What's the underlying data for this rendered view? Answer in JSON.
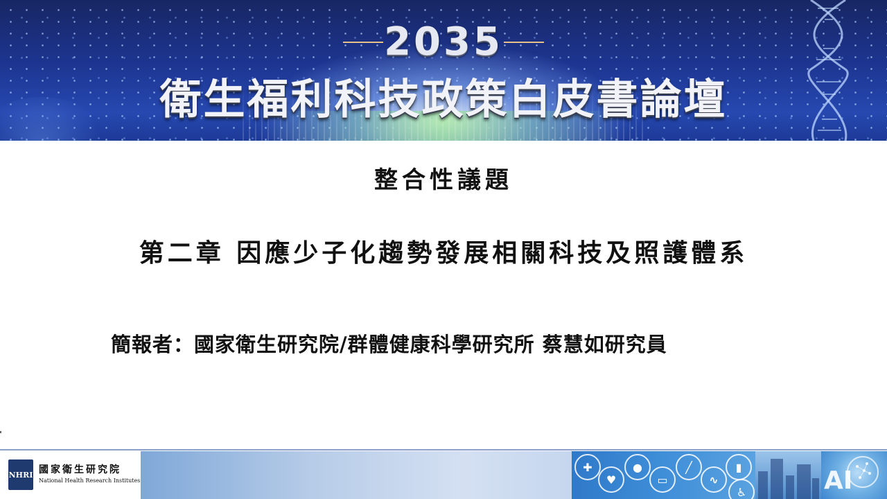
{
  "banner": {
    "year": "2035",
    "title": "衛生福利科技政策白皮書論壇"
  },
  "slide": {
    "heading": "整合性議題",
    "chapter": "第二章 因應少子化趨勢發展相關科技及照護體系",
    "presenter": "簡報者：國家衛生研究院/群體健康科學研究所 蔡慧如研究員"
  },
  "footer": {
    "logo_zh": "國家衛生研究院",
    "logo_en": "National Health Research Institutes",
    "logo_mark": "NHRI",
    "ai_label": "AI"
  },
  "colors": {
    "banner_dark": "#172663",
    "banner_mid": "#2648b0",
    "text": "#111111",
    "footer_blue": "#3f8ed8"
  }
}
